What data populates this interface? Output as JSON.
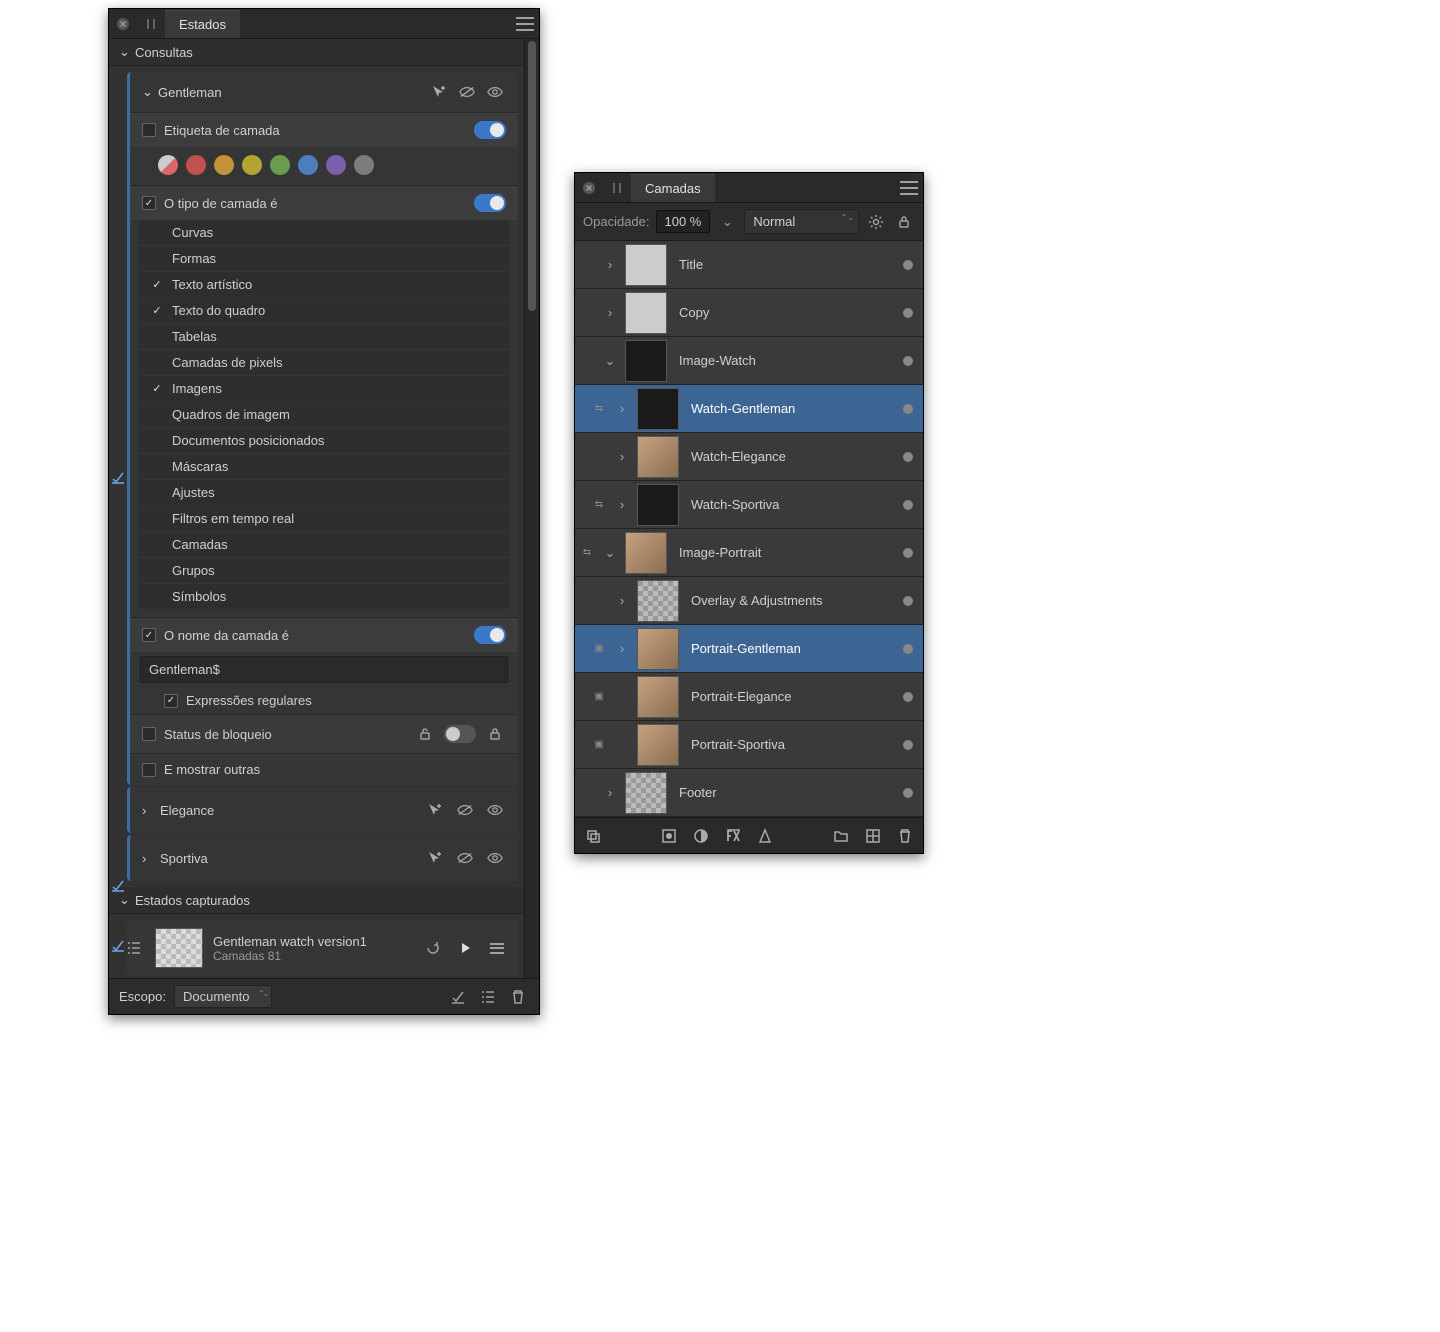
{
  "states_panel": {
    "tab_title": "Estados",
    "queries_section": "Consultas",
    "queries": [
      {
        "name": "Gentleman",
        "expanded": true,
        "label_row": {
          "title": "Etiqueta de camada",
          "enabled": true,
          "checked": false
        },
        "swatch_colors": [
          "#d0d0d0",
          "#c0514d",
          "#c2913c",
          "#b3a436",
          "#6a9d4d",
          "#4a7fbb",
          "#7c5fa8",
          "#7c7c7c"
        ],
        "type_row": {
          "title": "O tipo de camada é",
          "enabled": true,
          "checked": true
        },
        "types": [
          {
            "label": "Curvas",
            "checked": false
          },
          {
            "label": "Formas",
            "checked": false
          },
          {
            "label": "Texto artístico",
            "checked": true
          },
          {
            "label": "Texto do quadro",
            "checked": true
          },
          {
            "label": "Tabelas",
            "checked": false
          },
          {
            "label": "Camadas de pixels",
            "checked": false
          },
          {
            "label": "Imagens",
            "checked": true
          },
          {
            "label": "Quadros de imagem",
            "checked": false
          },
          {
            "label": "Documentos posicionados",
            "checked": false
          },
          {
            "label": "Máscaras",
            "checked": false
          },
          {
            "label": "Ajustes",
            "checked": false
          },
          {
            "label": "Filtros em tempo real",
            "checked": false
          },
          {
            "label": "Camadas",
            "checked": false
          },
          {
            "label": "Grupos",
            "checked": false
          },
          {
            "label": "Símbolos",
            "checked": false
          }
        ],
        "name_row": {
          "title": "O nome da camada é",
          "enabled": true,
          "checked": true,
          "value": "Gentleman$"
        },
        "regex_row": {
          "title": "Expressões regulares",
          "checked": true
        },
        "lock_row": {
          "title": "Status de bloqueio",
          "checked": false
        },
        "show_others": {
          "title": "E mostrar outras",
          "checked": false
        }
      },
      {
        "name": "Elegance",
        "expanded": false
      },
      {
        "name": "Sportiva",
        "expanded": false
      }
    ],
    "captured_section": "Estados capturados",
    "captured": {
      "title": "Gentleman watch version1",
      "sub": "Camadas 81"
    },
    "footer": {
      "scope_label": "Escopo:",
      "scope_value": "Documento"
    }
  },
  "layers_panel": {
    "tab_title": "Camadas",
    "opacity_label": "Opacidade:",
    "opacity_value": "100 %",
    "blend_mode": "Normal",
    "layers": [
      {
        "name": "Title",
        "depth": 0,
        "expand": ">",
        "thumb": "txt",
        "selected": false,
        "icons": ""
      },
      {
        "name": "Copy",
        "depth": 0,
        "expand": ">",
        "thumb": "txt",
        "selected": false,
        "icons": ""
      },
      {
        "name": "Image-Watch",
        "depth": 0,
        "expand": "v",
        "thumb": "dark",
        "selected": false,
        "icons": ""
      },
      {
        "name": "Watch-Gentleman",
        "depth": 1,
        "expand": ">",
        "thumb": "dark",
        "selected": true,
        "icons": "swap"
      },
      {
        "name": "Watch-Elegance",
        "depth": 1,
        "expand": ">",
        "thumb": "photo",
        "selected": false,
        "icons": ""
      },
      {
        "name": "Watch-Sportiva",
        "depth": 1,
        "expand": ">",
        "thumb": "dark",
        "selected": false,
        "icons": "swap"
      },
      {
        "name": "Image-Portrait",
        "depth": 0,
        "expand": "v",
        "thumb": "photo",
        "selected": false,
        "icons": "swap"
      },
      {
        "name": "Overlay & Adjustments",
        "depth": 1,
        "expand": ">",
        "thumb": "",
        "selected": false,
        "icons": ""
      },
      {
        "name": "Portrait-Gentleman",
        "depth": 1,
        "expand": ">",
        "thumb": "photo",
        "selected": true,
        "icons": "box"
      },
      {
        "name": "Portrait-Elegance",
        "depth": 1,
        "expand": "",
        "thumb": "photo",
        "selected": false,
        "icons": "box"
      },
      {
        "name": "Portrait-Sportiva",
        "depth": 1,
        "expand": "",
        "thumb": "photo",
        "selected": false,
        "icons": "box"
      },
      {
        "name": "Footer",
        "depth": 0,
        "expand": ">",
        "thumb": "",
        "selected": false,
        "icons": ""
      }
    ]
  }
}
